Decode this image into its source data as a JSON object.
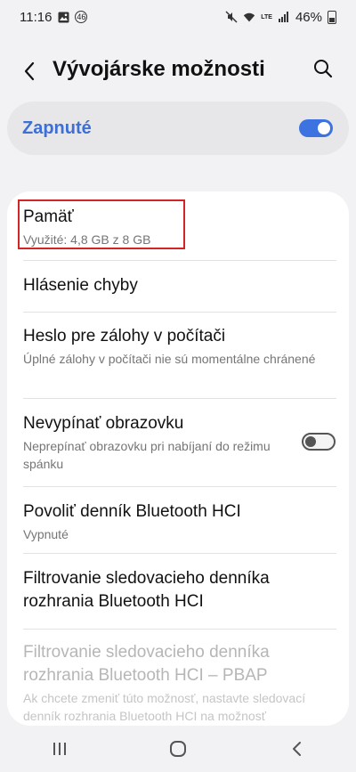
{
  "status": {
    "time": "11:16",
    "notification_badge": "46",
    "network_label": "LTE",
    "battery": "46%"
  },
  "appbar": {
    "title": "Vývojárske možnosti",
    "back_icon": "chevron-left-icon",
    "search_icon": "search-icon"
  },
  "master": {
    "label": "Zapnuté",
    "enabled": true,
    "accent": "#3d73e0"
  },
  "settings": {
    "memory": {
      "title": "Pamäť",
      "subtitle": "Využité: 4,8 GB z 8 GB"
    },
    "bug_report": {
      "title": "Hlásenie chyby"
    },
    "backup_password": {
      "title": "Heslo pre zálohy v počítači",
      "subtitle": "Úplné zálohy v počítači nie sú momentálne chránené"
    },
    "stay_awake": {
      "title": "Nevypínať obrazovku",
      "subtitle": "Neprepínať obrazovku pri nabíjaní do režimu spánku",
      "enabled": false
    },
    "bt_hci_log": {
      "title": "Povoliť denník Bluetooth HCI",
      "subtitle": "Vypnuté"
    },
    "bt_hci_filter": {
      "title": "Filtrovanie sledovacieho denníka rozhrania Bluetooth HCI"
    },
    "bt_hci_pbap": {
      "title": "Filtrovanie sledovacieho denníka rozhrania Bluetooth HCI – PBAP",
      "subtitle": "Ak chcete zmeniť túto možnosť, nastavte sledovací denník rozhrania Bluetooth HCI na možnosť Povoliť"
    }
  },
  "navbar": {
    "recents_icon": "recents-icon",
    "home_icon": "home-icon",
    "back_icon": "back-icon"
  }
}
